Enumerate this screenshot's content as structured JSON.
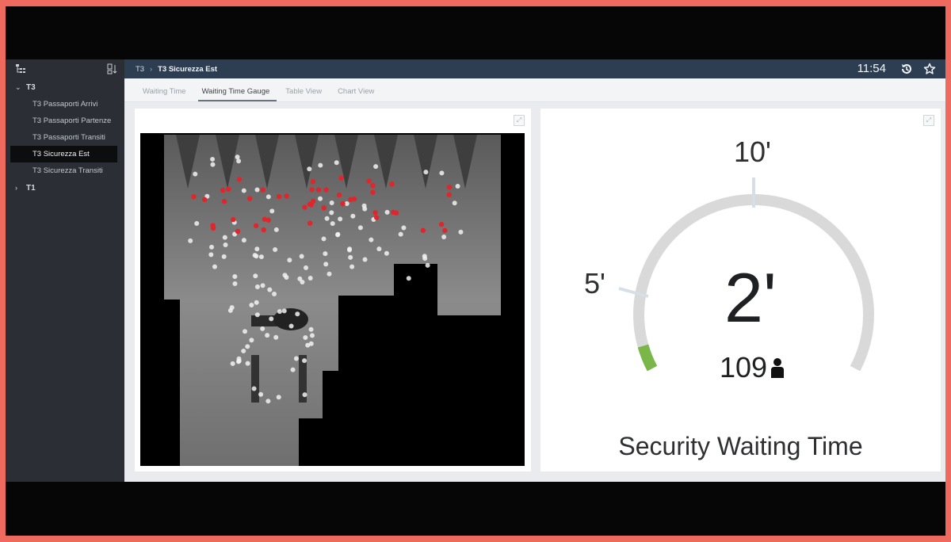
{
  "sidebar": {
    "groups": [
      {
        "label": "T3",
        "expanded": true,
        "items": [
          {
            "label": "T3 Passaporti Arrivi"
          },
          {
            "label": "T3 Passaporti Partenze"
          },
          {
            "label": "T3 Passaporti Transiti"
          },
          {
            "label": "T3 Sicurezza Est",
            "active": true
          },
          {
            "label": "T3 Sicurezza Transiti"
          }
        ]
      },
      {
        "label": "T1",
        "expanded": false,
        "items": []
      }
    ]
  },
  "header": {
    "breadcrumb": [
      "T3",
      "T3 Sicurezza Est"
    ],
    "time": "11:54"
  },
  "tabs": [
    "Waiting Time",
    "Waiting Time Gauge",
    "Table View",
    "Chart View"
  ],
  "active_tab": 1,
  "gauge": {
    "value": "2'",
    "count": "109",
    "title": "Security Waiting Time",
    "tick_5": "5'",
    "tick_10": "10'",
    "value_fraction": 0.2,
    "colors": {
      "track": "#d9d9d9",
      "fill": "#7ab648",
      "tick": "#d6dfe6"
    }
  },
  "map": {
    "red_dots": 46,
    "white_dots": 120
  }
}
